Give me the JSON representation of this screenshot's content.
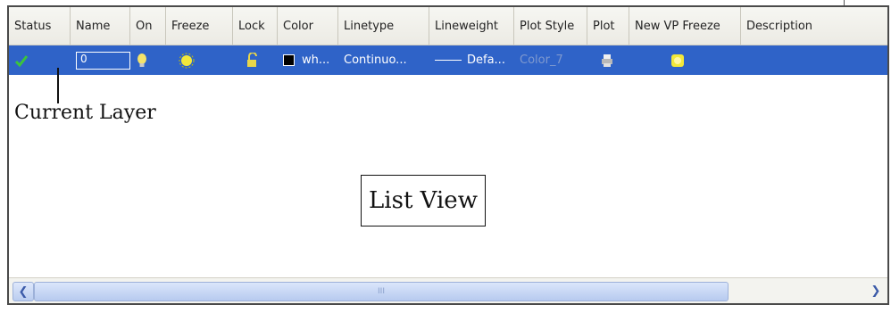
{
  "columns": [
    "Status",
    "Name",
    "On",
    "Freeze",
    "Lock",
    "Color",
    "Linetype",
    "Lineweight",
    "Plot Style",
    "Plot",
    "New VP Freeze",
    "Description"
  ],
  "row": {
    "status_icon": "checkmark-icon",
    "name": "0",
    "on_icon": "lightbulb-on-icon",
    "freeze_icon": "sun-icon",
    "lock_icon": "padlock-unlocked-icon",
    "color_name": "wh...",
    "linetype": "Continuo...",
    "lineweight": "Defa...",
    "plot_style": "Color_7",
    "plot_icon": "printer-icon",
    "vp_freeze_icon": "vp-sun-icon"
  },
  "annotations": {
    "current_layer": "Current Layer",
    "list_view": "List View"
  },
  "scrollbar": {
    "left_glyph": "❮",
    "right_glyph": "❯",
    "thumb_grip": "III"
  },
  "colors": {
    "selection": "#2f63c8",
    "check": "#3cc43c",
    "bulb": "#f4e36a",
    "sun": "#f2e83a"
  }
}
